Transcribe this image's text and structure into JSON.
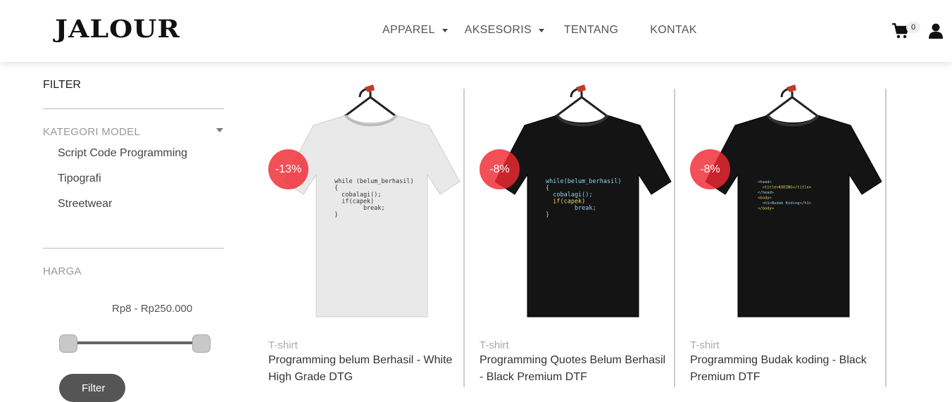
{
  "header": {
    "logo": "JALOUR",
    "nav": [
      {
        "label": "APPAREL",
        "has_dropdown": true
      },
      {
        "label": "AKSESORIS",
        "has_dropdown": true
      },
      {
        "label": "TENTANG",
        "has_dropdown": false
      },
      {
        "label": "KONTAK",
        "has_dropdown": false
      }
    ],
    "cart_count": "0",
    "icons": {
      "cart": "cart-icon",
      "user": "user-icon"
    }
  },
  "sidebar": {
    "filter_title": "FILTER",
    "category_title": "KATEGORI MODEL",
    "categories": [
      "Script Code Programming",
      "Tipografi",
      "Streetwear"
    ],
    "price_title": "HARGA",
    "price_range": "Rp8 - Rp250.000",
    "price_min_fraction": 0.0,
    "price_max_fraction": 1.0,
    "filter_button": "Filter"
  },
  "products": [
    {
      "type": "T-shirt",
      "name": "Programming belum Berhasil - White High Grade DTG",
      "discount": "-13%",
      "shirt_color": "#e9e9e9",
      "print_lines": [
        "while (belum_berhasil)",
        "{",
        "  cobalagi();",
        "  if(capek)",
        "        break;",
        "}"
      ]
    },
    {
      "type": "T-shirt",
      "name": "Programming Quotes Belum Berhasil - Black Premium DTF",
      "discount": "-8%",
      "shirt_color": "#141414",
      "print_lines": [
        "while(belum_berhasil)",
        "{",
        "  cobalagi();",
        "  if(capek)",
        "        break;",
        "}"
      ]
    },
    {
      "type": "T-shirt",
      "name": "Programming Budak koding - Black Premium DTF",
      "discount": "-8%",
      "shirt_color": "#141414",
      "print_lines": [
        "<head>",
        "  <title>KODING</title>",
        "</head>",
        "<body>",
        "  <h1>Budak Koding</h1>",
        "</body>"
      ]
    }
  ],
  "colors": {
    "accent_discount": "#f02832",
    "text_dark": "#333333",
    "muted": "#999999"
  }
}
